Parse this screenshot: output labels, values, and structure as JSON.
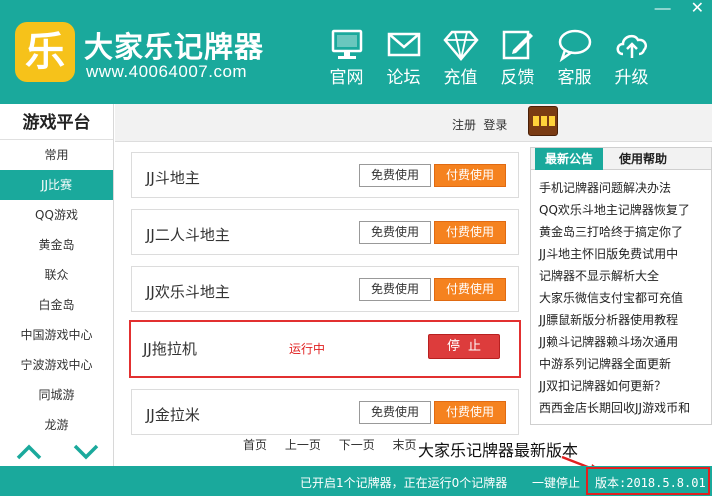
{
  "app": {
    "logo_char": "乐",
    "name": "大家乐记牌器",
    "url": "www.40064007.com"
  },
  "window_controls": {
    "minimize": "—",
    "close": "✕"
  },
  "nav": [
    {
      "label": "官网",
      "icon": "monitor-icon"
    },
    {
      "label": "论坛",
      "icon": "envelope-icon"
    },
    {
      "label": "充值",
      "icon": "diamond-icon"
    },
    {
      "label": "反馈",
      "icon": "edit-icon"
    },
    {
      "label": "客服",
      "icon": "chat-bubble-icon"
    },
    {
      "label": "升级",
      "icon": "cloud-upload-icon"
    }
  ],
  "sidebar": {
    "title": "游戏平台",
    "items": [
      {
        "label": "常用"
      },
      {
        "label": "JJ比赛"
      },
      {
        "label": "QQ游戏"
      },
      {
        "label": "黄金岛"
      },
      {
        "label": "联众"
      },
      {
        "label": "白金岛"
      },
      {
        "label": "中国游戏中心"
      },
      {
        "label": "宁波游戏中心"
      },
      {
        "label": "同城游"
      },
      {
        "label": "龙游"
      }
    ],
    "active_index": 1
  },
  "topbar": {
    "register": "注册",
    "login": "登录",
    "slot_icon": "slot-machine-icon"
  },
  "games": [
    {
      "name": "JJ斗地主",
      "free": "免费使用",
      "pay": "付费使用"
    },
    {
      "name": "JJ二人斗地主",
      "free": "免费使用",
      "pay": "付费使用"
    },
    {
      "name": "JJ欢乐斗地主",
      "free": "免费使用",
      "pay": "付费使用"
    },
    {
      "name": "JJ拖拉机",
      "status": "运行中",
      "stop": "停止"
    },
    {
      "name": "JJ金拉米",
      "free": "免费使用",
      "pay": "付费使用"
    }
  ],
  "pager": {
    "first": "首页",
    "prev": "上一页",
    "next": "下一页",
    "last": "末页"
  },
  "news": {
    "tab_latest": "最新公告",
    "tab_help": "使用帮助",
    "items": [
      "手机记牌器问题解决办法",
      "QQ欢乐斗地主记牌器恢复了",
      "黄金岛三打哈终于搞定你了",
      "JJ斗地主怀旧版免费试用中",
      "记牌器不显示解析大全",
      "大家乐微信支付宝都可充值",
      "JJ膘鼠新版分析器使用教程",
      "JJ赖斗记牌器赖斗场次通用",
      "中游系列记牌器全面更新",
      "JJ双扣记牌器如何更新？",
      "西西金店长期回收JJ游戏币和"
    ]
  },
  "annotation": "大家乐记牌器最新版本",
  "status": {
    "text": "已开启1个记牌器，正在运行0个记牌器",
    "stop_all": "一键停止",
    "version": "版本:2018.5.8.01"
  },
  "colors": {
    "brand": "#1aa99c",
    "logo": "#f6c21a",
    "pay_button": "#f5821f",
    "stop_button": "#dd3c3c",
    "highlight": "#e02020"
  }
}
